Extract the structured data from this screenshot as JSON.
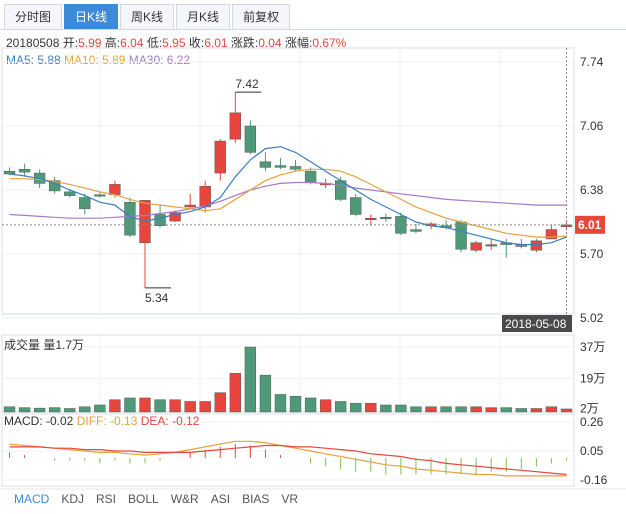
{
  "tabs": [
    "分时图",
    "日K线",
    "周K线",
    "月K线",
    "前复权"
  ],
  "active_tab": 1,
  "quote": {
    "date": "20180508",
    "open_label": "开:",
    "open": "5.99",
    "high_label": "高:",
    "high": "6.04",
    "low_label": "低:",
    "low": "5.95",
    "close_label": "收:",
    "close": "6.01",
    "change_label": "涨跌:",
    "change": "0.04",
    "pct_label": "涨幅:",
    "pct": "0.67%"
  },
  "ma_legend": {
    "ma5": "MA5: 5.88",
    "ma10": "MA10: 5.89",
    "ma30": "MA30: 6.22"
  },
  "volume_header": "成交量 量1.7万",
  "macd_header": {
    "macd": "MACD: -0.02",
    "dif": "DIFF: -0.13",
    "dea": "DEA: -0.12"
  },
  "indicator_tabs": [
    "MACD",
    "KDJ",
    "RSI",
    "BOLL",
    "W&R",
    "ASI",
    "BIAS",
    "VR"
  ],
  "active_indicator": 0,
  "colors": {
    "up": "#e8463c",
    "down": "#4e9a78",
    "ma5": "#3a7fc0",
    "ma10": "#e6a23c",
    "ma30": "#a77ac9",
    "price_tag": "#e8463c",
    "date_tag": "#4a4a4a"
  },
  "chart_data": {
    "type": "candlestick",
    "price_axis": {
      "ticks": [
        "7.74",
        "7.06",
        "6.38",
        "5.70",
        "5.02"
      ],
      "ylim": [
        5.02,
        7.74
      ]
    },
    "volume_axis": {
      "ticks": [
        "37万",
        "19万",
        "2万"
      ],
      "ylim": [
        0,
        37
      ]
    },
    "macd_axis": {
      "ticks": [
        "0.26",
        "0.05",
        "-0.16"
      ],
      "ylim": [
        -0.16,
        0.26
      ]
    },
    "annotations": {
      "high": "7.42",
      "low": "5.34",
      "last_price": "6.01",
      "last_date": "2018-05-08"
    },
    "candles": [
      {
        "o": 6.58,
        "h": 6.62,
        "l": 6.54,
        "c": 6.55
      },
      {
        "o": 6.6,
        "h": 6.66,
        "l": 6.52,
        "c": 6.57
      },
      {
        "o": 6.56,
        "h": 6.6,
        "l": 6.4,
        "c": 6.45
      },
      {
        "o": 6.48,
        "h": 6.52,
        "l": 6.34,
        "c": 6.37
      },
      {
        "o": 6.36,
        "h": 6.39,
        "l": 6.3,
        "c": 6.32
      },
      {
        "o": 6.3,
        "h": 6.34,
        "l": 6.12,
        "c": 6.18
      },
      {
        "o": 6.33,
        "h": 6.36,
        "l": 6.3,
        "c": 6.32
      },
      {
        "o": 6.33,
        "h": 6.48,
        "l": 6.3,
        "c": 6.44
      },
      {
        "o": 6.25,
        "h": 6.3,
        "l": 5.88,
        "c": 5.9
      },
      {
        "o": 5.82,
        "h": 6.27,
        "l": 5.34,
        "c": 6.27
      },
      {
        "o": 6.12,
        "h": 6.23,
        "l": 5.98,
        "c": 6.0
      },
      {
        "o": 6.05,
        "h": 6.16,
        "l": 6.04,
        "c": 6.14
      },
      {
        "o": 6.2,
        "h": 6.34,
        "l": 6.18,
        "c": 6.22
      },
      {
        "o": 6.2,
        "h": 6.48,
        "l": 6.14,
        "c": 6.42
      },
      {
        "o": 6.56,
        "h": 6.92,
        "l": 6.48,
        "c": 6.9
      },
      {
        "o": 6.92,
        "h": 7.42,
        "l": 6.88,
        "c": 7.2
      },
      {
        "o": 7.06,
        "h": 7.12,
        "l": 6.76,
        "c": 6.78
      },
      {
        "o": 6.68,
        "h": 6.78,
        "l": 6.58,
        "c": 6.62
      },
      {
        "o": 6.64,
        "h": 6.72,
        "l": 6.6,
        "c": 6.62
      },
      {
        "o": 6.63,
        "h": 6.7,
        "l": 6.58,
        "c": 6.6
      },
      {
        "o": 6.58,
        "h": 6.62,
        "l": 6.44,
        "c": 6.46
      },
      {
        "o": 6.45,
        "h": 6.5,
        "l": 6.4,
        "c": 6.45
      },
      {
        "o": 6.48,
        "h": 6.52,
        "l": 6.26,
        "c": 6.28
      },
      {
        "o": 6.3,
        "h": 6.34,
        "l": 6.1,
        "c": 6.12
      },
      {
        "o": 6.08,
        "h": 6.12,
        "l": 6.0,
        "c": 6.08
      },
      {
        "o": 6.09,
        "h": 6.13,
        "l": 6.04,
        "c": 6.08
      },
      {
        "o": 6.1,
        "h": 6.14,
        "l": 5.9,
        "c": 5.92
      },
      {
        "o": 5.96,
        "h": 6.02,
        "l": 5.92,
        "c": 5.94
      },
      {
        "o": 6.0,
        "h": 6.04,
        "l": 5.96,
        "c": 6.02
      },
      {
        "o": 6.0,
        "h": 6.06,
        "l": 5.96,
        "c": 5.98
      },
      {
        "o": 6.04,
        "h": 6.06,
        "l": 5.72,
        "c": 5.75
      },
      {
        "o": 5.74,
        "h": 5.84,
        "l": 5.72,
        "c": 5.82
      },
      {
        "o": 5.8,
        "h": 5.86,
        "l": 5.74,
        "c": 5.8
      },
      {
        "o": 5.82,
        "h": 5.86,
        "l": 5.66,
        "c": 5.8
      },
      {
        "o": 5.8,
        "h": 5.86,
        "l": 5.76,
        "c": 5.78
      },
      {
        "o": 5.74,
        "h": 5.86,
        "l": 5.72,
        "c": 5.84
      },
      {
        "o": 5.86,
        "h": 6.01,
        "l": 5.86,
        "c": 5.96
      },
      {
        "o": 5.99,
        "h": 6.04,
        "l": 5.95,
        "c": 6.01
      }
    ],
    "ma5": [
      6.55,
      6.53,
      6.5,
      6.45,
      6.38,
      6.32,
      6.25,
      6.22,
      6.1,
      6.05,
      6.08,
      6.12,
      6.15,
      6.2,
      6.3,
      6.52,
      6.7,
      6.82,
      6.84,
      6.78,
      6.68,
      6.58,
      6.48,
      6.38,
      6.28,
      6.2,
      6.12,
      6.04,
      6.0,
      5.98,
      5.94,
      5.9,
      5.86,
      5.82,
      5.8,
      5.8,
      5.82,
      5.88
    ],
    "ma10": [
      6.5,
      6.5,
      6.49,
      6.47,
      6.44,
      6.4,
      6.36,
      6.33,
      6.28,
      6.24,
      6.22,
      6.2,
      6.18,
      6.16,
      6.18,
      6.28,
      6.38,
      6.48,
      6.54,
      6.58,
      6.6,
      6.6,
      6.58,
      6.52,
      6.44,
      6.36,
      6.28,
      6.2,
      6.14,
      6.08,
      6.04,
      6.0,
      5.96,
      5.92,
      5.9,
      5.88,
      5.88,
      5.89
    ],
    "ma30": [
      6.12,
      6.11,
      6.1,
      6.09,
      6.08,
      6.08,
      6.08,
      6.09,
      6.1,
      6.11,
      6.13,
      6.15,
      6.18,
      6.21,
      6.26,
      6.32,
      6.38,
      6.42,
      6.45,
      6.46,
      6.46,
      6.45,
      6.43,
      6.4,
      6.38,
      6.36,
      6.34,
      6.32,
      6.3,
      6.28,
      6.27,
      6.26,
      6.25,
      6.24,
      6.23,
      6.22,
      6.22,
      6.22
    ],
    "volume": [
      3,
      2.5,
      2.2,
      2.5,
      2,
      3,
      4,
      7,
      8,
      8,
      7,
      7,
      6,
      6,
      11,
      22,
      37,
      21,
      10,
      9,
      8,
      7,
      6,
      5,
      5,
      4,
      4,
      3,
      3,
      3,
      3,
      3,
      2.5,
      2.5,
      2,
      2,
      3,
      1.7
    ],
    "macd_dif": [
      0.1,
      0.09,
      0.08,
      0.07,
      0.06,
      0.05,
      0.04,
      0.04,
      0.03,
      0.02,
      0.03,
      0.04,
      0.06,
      0.08,
      0.1,
      0.12,
      0.12,
      0.11,
      0.09,
      0.07,
      0.05,
      0.03,
      0.01,
      -0.01,
      -0.03,
      -0.05,
      -0.06,
      -0.08,
      -0.09,
      -0.1,
      -0.11,
      -0.12,
      -0.12,
      -0.13,
      -0.13,
      -0.13,
      -0.13,
      -0.13
    ],
    "macd_dea": [
      0.08,
      0.08,
      0.08,
      0.07,
      0.07,
      0.06,
      0.06,
      0.05,
      0.05,
      0.04,
      0.04,
      0.04,
      0.04,
      0.05,
      0.06,
      0.07,
      0.08,
      0.09,
      0.09,
      0.08,
      0.08,
      0.07,
      0.06,
      0.05,
      0.03,
      0.02,
      0.01,
      -0.01,
      -0.02,
      -0.04,
      -0.05,
      -0.06,
      -0.07,
      -0.08,
      -0.09,
      -0.1,
      -0.11,
      -0.12
    ],
    "macd_hist": [
      0.04,
      0.02,
      0.0,
      -0.02,
      -0.02,
      -0.02,
      -0.04,
      -0.02,
      -0.04,
      -0.04,
      -0.02,
      0.0,
      0.04,
      0.06,
      0.08,
      0.1,
      0.09,
      0.06,
      0.02,
      0.0,
      -0.04,
      -0.06,
      -0.08,
      -0.1,
      -0.1,
      -0.12,
      -0.12,
      -0.12,
      -0.12,
      -0.12,
      -0.12,
      -0.12,
      -0.1,
      -0.1,
      -0.08,
      -0.06,
      -0.04,
      -0.02
    ]
  }
}
